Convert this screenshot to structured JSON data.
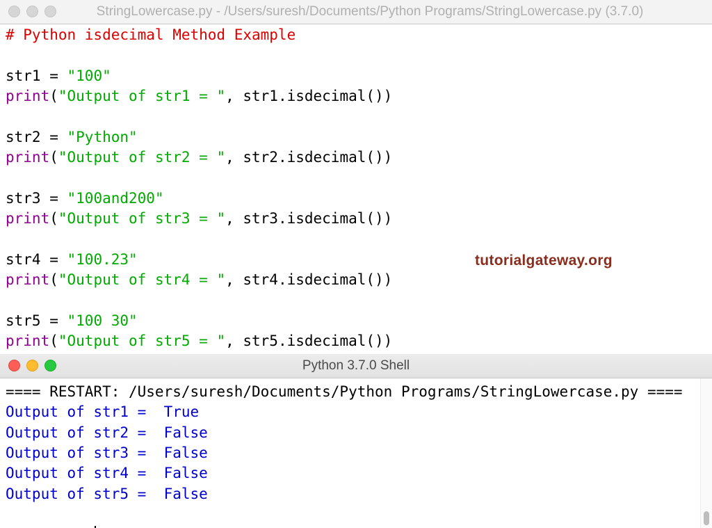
{
  "editor": {
    "title": "StringLowercase.py - /Users/suresh/Documents/Python Programs/StringLowercase.py (3.7.0)",
    "lines": [
      [
        {
          "t": "# Python isdecimal Method Example",
          "c": "cm"
        }
      ],
      [],
      [
        {
          "t": "str1 = ",
          "c": "df"
        },
        {
          "t": "\"100\"",
          "c": "st"
        }
      ],
      [
        {
          "t": "print",
          "c": "bi"
        },
        {
          "t": "(",
          "c": "df"
        },
        {
          "t": "\"Output of str1 = \"",
          "c": "st"
        },
        {
          "t": ", str1.isdecimal())",
          "c": "df"
        }
      ],
      [],
      [
        {
          "t": "str2 = ",
          "c": "df"
        },
        {
          "t": "\"Python\"",
          "c": "st"
        }
      ],
      [
        {
          "t": "print",
          "c": "bi"
        },
        {
          "t": "(",
          "c": "df"
        },
        {
          "t": "\"Output of str2 = \"",
          "c": "st"
        },
        {
          "t": ", str2.isdecimal())",
          "c": "df"
        }
      ],
      [],
      [
        {
          "t": "str3 = ",
          "c": "df"
        },
        {
          "t": "\"100and200\"",
          "c": "st"
        }
      ],
      [
        {
          "t": "print",
          "c": "bi"
        },
        {
          "t": "(",
          "c": "df"
        },
        {
          "t": "\"Output of str3 = \"",
          "c": "st"
        },
        {
          "t": ", str3.isdecimal())",
          "c": "df"
        }
      ],
      [],
      [
        {
          "t": "str4 = ",
          "c": "df"
        },
        {
          "t": "\"100.23\"",
          "c": "st"
        }
      ],
      [
        {
          "t": "print",
          "c": "bi"
        },
        {
          "t": "(",
          "c": "df"
        },
        {
          "t": "\"Output of str4 = \"",
          "c": "st"
        },
        {
          "t": ", str4.isdecimal())",
          "c": "df"
        }
      ],
      [],
      [
        {
          "t": "str5 = ",
          "c": "df"
        },
        {
          "t": "\"100 30\"",
          "c": "st"
        }
      ],
      [
        {
          "t": "print",
          "c": "bi"
        },
        {
          "t": "(",
          "c": "df"
        },
        {
          "t": "\"Output of str5 = \"",
          "c": "st"
        },
        {
          "t": ", str5.isdecimal())",
          "c": "df"
        }
      ]
    ]
  },
  "watermark": "tutorialgateway.org",
  "shell": {
    "title": "Python 3.7.0 Shell",
    "restart": "==== RESTART: /Users/suresh/Documents/Python Programs/StringLowercase.py ====",
    "outputs": [
      "Output of str1 =  True",
      "Output of str2 =  False",
      "Output of str3 =  False",
      "Output of str4 =  False",
      "Output of str5 =  False"
    ],
    "prompt": ">>> "
  },
  "colors": {
    "comment": "#dd0000",
    "builtin": "#900090",
    "string": "#00aa00",
    "shell_output": "#0000cc",
    "prompt": "#8b0000",
    "watermark": "#8b2d1c"
  }
}
